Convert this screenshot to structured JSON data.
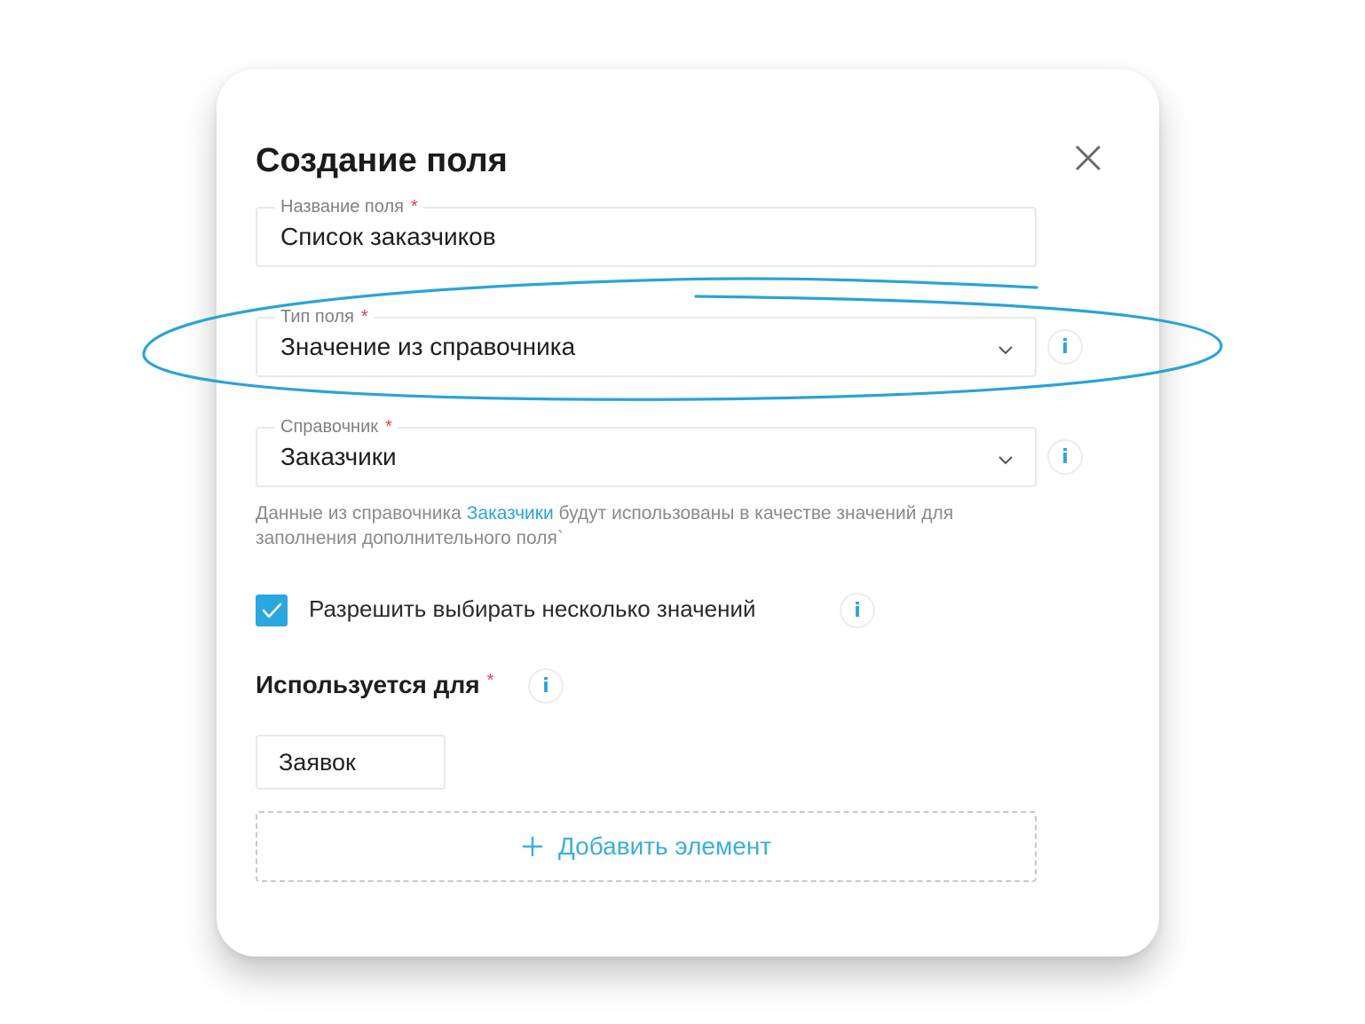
{
  "modal": {
    "title": "Создание поля",
    "close_icon": "close-icon"
  },
  "field_name": {
    "label": "Название поля",
    "required_mark": "*",
    "value": "Список заказчиков"
  },
  "field_type": {
    "label": "Тип поля",
    "required_mark": "*",
    "value": "Значение из справочника",
    "chevron_icon": "chevron-down-icon",
    "info_icon": "info-icon",
    "info_glyph": "i"
  },
  "reference": {
    "label": "Справочник",
    "required_mark": "*",
    "value": "Заказчики",
    "chevron_icon": "chevron-down-icon",
    "info_icon": "info-icon",
    "info_glyph": "i"
  },
  "hint": {
    "prefix": "Данные из справочника ",
    "link": "Заказчики",
    "suffix": " будут использованы в качестве значений для заполнения дополнительного поля`"
  },
  "multi_select": {
    "checked": true,
    "label": "Разрешить выбирать несколько значений",
    "info_glyph": "i"
  },
  "used_for": {
    "title": "Используется для",
    "required_mark": "*",
    "info_glyph": "i",
    "items": [
      "Заявок"
    ]
  },
  "add_element": {
    "icon": "plus-icon",
    "label": "Добавить элемент"
  },
  "colors": {
    "accent": "#2aa3dc",
    "required": "#e0424b",
    "annotation": "#2aa3d8",
    "checkbox": "#2ba7e0"
  }
}
